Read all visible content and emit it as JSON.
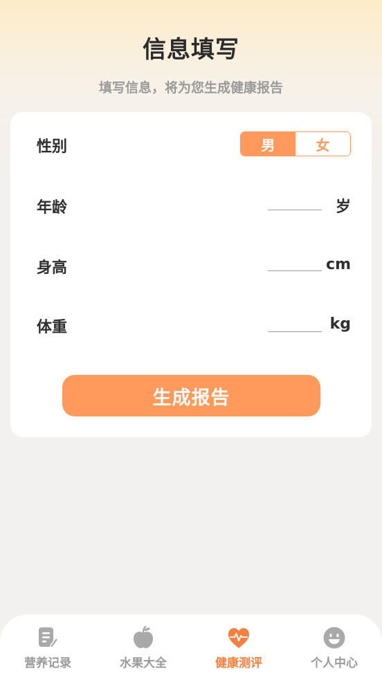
{
  "header": {
    "title": "信息填写",
    "subtitle": "填写信息，将为您生成健康报告"
  },
  "form": {
    "gender": {
      "label": "性别",
      "options": [
        "男",
        "女"
      ],
      "selected": "男"
    },
    "age": {
      "label": "年龄",
      "value": "",
      "unit": "岁"
    },
    "height": {
      "label": "身高",
      "value": "",
      "unit": "cm"
    },
    "weight": {
      "label": "体重",
      "value": "",
      "unit": "kg"
    },
    "submit_label": "生成报告"
  },
  "tabbar": {
    "items": [
      {
        "label": "营养记录",
        "icon": "notepad-pen-icon"
      },
      {
        "label": "水果大全",
        "icon": "apple-icon"
      },
      {
        "label": "健康测评",
        "icon": "heart-pulse-icon",
        "active": true
      },
      {
        "label": "个人中心",
        "icon": "smiley-face-icon"
      }
    ]
  },
  "colors": {
    "accent": "#ff9a5c",
    "active_tab": "#f5803f",
    "inactive_tab": "#9a9a9a"
  }
}
